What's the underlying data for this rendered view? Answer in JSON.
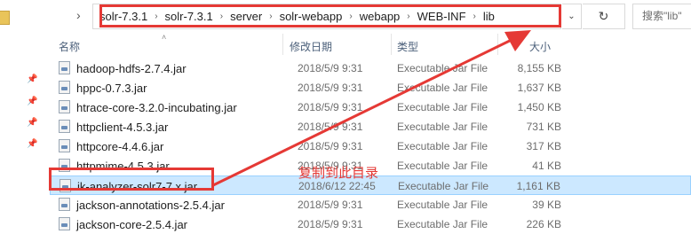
{
  "address_bar": {
    "nav_arrow": "›",
    "breadcrumb": [
      "solr-7.3.1",
      "solr-7.3.1",
      "server",
      "solr-webapp",
      "webapp",
      "WEB-INF",
      "lib"
    ],
    "separator": "›",
    "dropdown_icon": "chevron-down-icon",
    "refresh_icon": "refresh-icon",
    "refresh_glyph": "↻",
    "dropdown_glyph": "⌄"
  },
  "search": {
    "placeholder": "搜索\"lib\""
  },
  "columns": {
    "name": "名称",
    "modified": "修改日期",
    "type": "类型",
    "size": "大小"
  },
  "files": [
    {
      "name": "hadoop-hdfs-2.7.4.jar",
      "modified": "2018/5/9 9:31",
      "type": "Executable Jar File",
      "size": "8,155 KB"
    },
    {
      "name": "hppc-0.7.3.jar",
      "modified": "2018/5/9 9:31",
      "type": "Executable Jar File",
      "size": "1,637 KB"
    },
    {
      "name": "htrace-core-3.2.0-incubating.jar",
      "modified": "2018/5/9 9:31",
      "type": "Executable Jar File",
      "size": "1,450 KB"
    },
    {
      "name": "httpclient-4.5.3.jar",
      "modified": "2018/5/9 9:31",
      "type": "Executable Jar File",
      "size": "731 KB"
    },
    {
      "name": "httpcore-4.4.6.jar",
      "modified": "2018/5/9 9:31",
      "type": "Executable Jar File",
      "size": "317 KB"
    },
    {
      "name": "httpmime-4.5.3.jar",
      "modified": "2018/5/9 9:31",
      "type": "Executable Jar File",
      "size": "41 KB"
    },
    {
      "name": "ik-analyzer-solr7-7.x.jar",
      "modified": "2018/6/12 22:45",
      "type": "Executable Jar File",
      "size": "1,161 KB",
      "selected": true
    },
    {
      "name": "jackson-annotations-2.5.4.jar",
      "modified": "2018/5/9 9:31",
      "type": "Executable Jar File",
      "size": "39 KB"
    },
    {
      "name": "jackson-core-2.5.4.jar",
      "modified": "2018/5/9 9:31",
      "type": "Executable Jar File",
      "size": "226 KB"
    }
  ],
  "annotation": {
    "text": "复制到此目录",
    "color": "#e53935"
  },
  "colors": {
    "selection_bg": "#cce8ff",
    "selection_border": "#99d1ff",
    "header_text": "#4c607a",
    "annotation_red": "#e53935"
  }
}
